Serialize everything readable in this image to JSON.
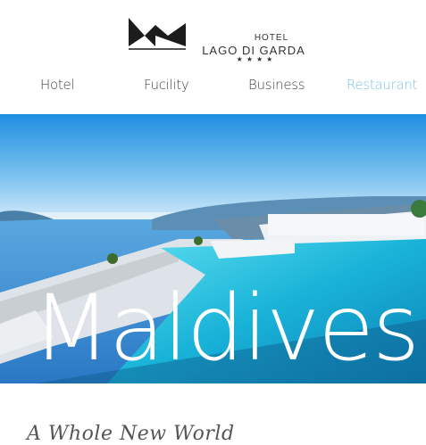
{
  "brand": {
    "top": "HOTEL",
    "name": "LAGO DI GARDA",
    "stars": "★★★★"
  },
  "nav": {
    "items": [
      {
        "label": "Hotel"
      },
      {
        "label": "Fucility"
      },
      {
        "label": "Business"
      },
      {
        "label": "Restaurant"
      }
    ],
    "active_color": "#7ec3e8"
  },
  "hero": {
    "title": "Maldives"
  },
  "section": {
    "subtitle": "A Whole New World"
  }
}
